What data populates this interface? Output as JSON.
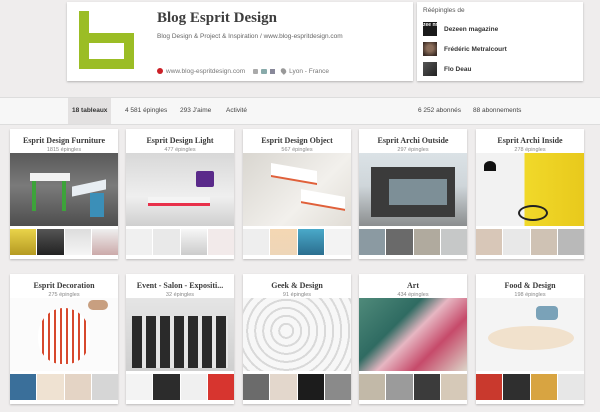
{
  "profile": {
    "name": "Blog Esprit Design",
    "description": "Blog Design & Project & Inspiration / www.blog-espritdesign.com",
    "website": "www.blog-espritdesign.com",
    "location": "Lyon - France",
    "logo_color": "#9bbd25"
  },
  "repins": {
    "title": "Réépingles de",
    "items": [
      {
        "name": "Dezeen magazine",
        "avatar_text": "zee nn"
      },
      {
        "name": "Frédéric Metralcourt"
      },
      {
        "name": "Flo Deau"
      }
    ]
  },
  "tabs": [
    {
      "label": "18 tableaux"
    },
    {
      "label": "4 581 épingles"
    },
    {
      "label": "293 J'aime"
    },
    {
      "label": "Activité"
    },
    {
      "label": "6 252 abonnés"
    },
    {
      "label": "88 abonnements"
    }
  ],
  "boards": [
    {
      "title": "Esprit Design Furniture",
      "count": "1815 épingles"
    },
    {
      "title": "Esprit Design Light",
      "count": "477 épingles"
    },
    {
      "title": "Esprit Design Object",
      "count": "567 épingles"
    },
    {
      "title": "Esprit Archi Outside",
      "count": "297 épingles"
    },
    {
      "title": "Esprit Archi Inside",
      "count": "278 épingles"
    },
    {
      "title": "Esprit Decoration",
      "count": "275 épingles"
    },
    {
      "title": "Event - Salon - Expositi...",
      "count": "32 épingles"
    },
    {
      "title": "Geek & Design",
      "count": "91 épingles"
    },
    {
      "title": "Art",
      "count": "434 épingles"
    },
    {
      "title": "Food & Design",
      "count": "198 épingles"
    }
  ]
}
